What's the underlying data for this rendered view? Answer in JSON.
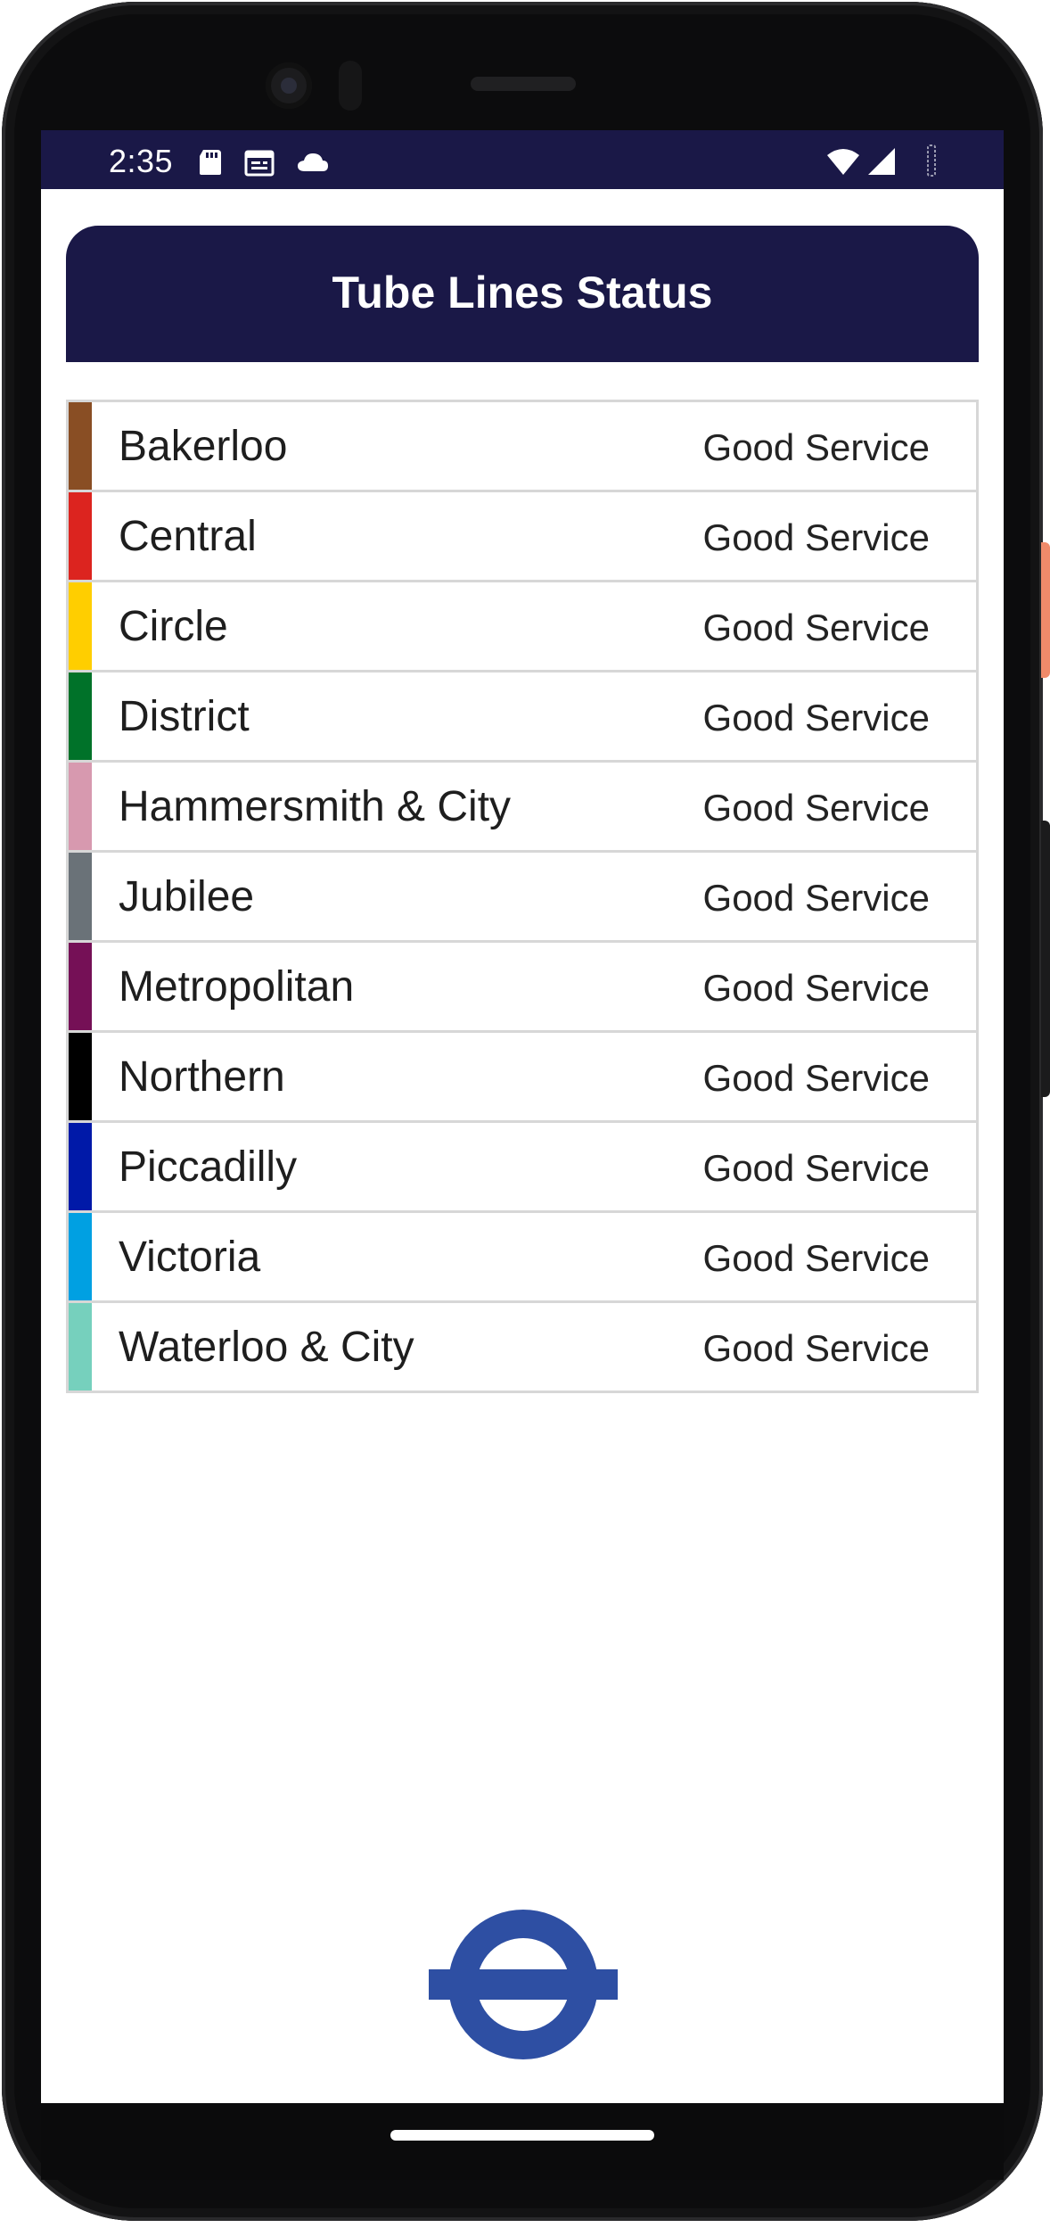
{
  "statusbar": {
    "time": "2:35",
    "left_icons": [
      "sd-card-icon",
      "calendar-icon",
      "cloud-icon"
    ],
    "right_icons": [
      "wifi-icon",
      "cell-signal-icon",
      "battery-icon"
    ]
  },
  "header": {
    "title": "Tube Lines Status"
  },
  "lines": [
    {
      "name": "Bakerloo",
      "status": "Good Service",
      "color": "#894E24"
    },
    {
      "name": "Central",
      "status": "Good Service",
      "color": "#DC241F"
    },
    {
      "name": "Circle",
      "status": "Good Service",
      "color": "#FFCE00"
    },
    {
      "name": "District",
      "status": "Good Service",
      "color": "#007229"
    },
    {
      "name": "Hammersmith & City",
      "status": "Good Service",
      "color": "#D799AF"
    },
    {
      "name": "Jubilee",
      "status": "Good Service",
      "color": "#6A7278"
    },
    {
      "name": "Metropolitan",
      "status": "Good Service",
      "color": "#751056"
    },
    {
      "name": "Northern",
      "status": "Good Service",
      "color": "#000000"
    },
    {
      "name": "Piccadilly",
      "status": "Good Service",
      "color": "#0019A8"
    },
    {
      "name": "Victoria",
      "status": "Good Service",
      "color": "#00A0E2"
    },
    {
      "name": "Waterloo & City",
      "status": "Good Service",
      "color": "#76D0BD"
    }
  ],
  "logo": {
    "name": "roundel-logo",
    "color": "#2E4FA3"
  },
  "colors": {
    "brand_navy": "#1A1847",
    "divider": "#D7D7D7"
  }
}
